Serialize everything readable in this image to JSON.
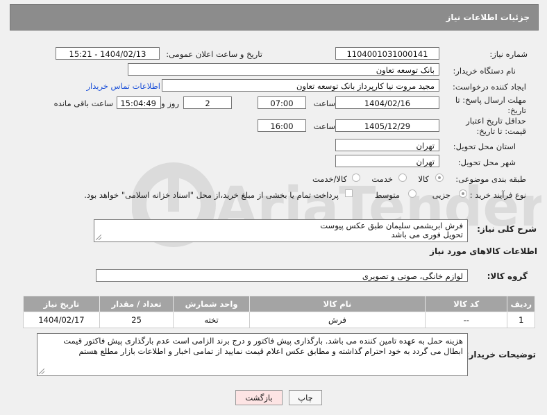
{
  "header": {
    "title": "جزئیات اطلاعات نیاز"
  },
  "form": {
    "need_number": {
      "label": "شماره نیاز:",
      "value": "1104001031000141"
    },
    "announce_datetime": {
      "label": "تاریخ و ساعت اعلان عمومی:",
      "value": "1404/02/13 - 15:21"
    },
    "buyer_org": {
      "label": "نام دستگاه خریدار:",
      "value": "بانک توسعه تعاون"
    },
    "requester": {
      "label": "ایجاد کننده درخواست:",
      "value": "مجید مروت نیا کارپرداز بانک توسعه تعاون",
      "contact_link": "اطلاعات تماس خریدار"
    },
    "reply_deadline": {
      "label": "مهلت ارسال پاسخ: تا تاریخ:",
      "date": "1404/02/16",
      "time_label": "ساعت",
      "time": "07:00",
      "days": "2",
      "days_label": "روز و",
      "remaining": "15:04:49",
      "remaining_label": "ساعت باقی مانده"
    },
    "price_validity": {
      "label": "حداقل تاریخ اعتبار قیمت: تا تاریخ:",
      "date": "1405/12/29",
      "time_label": "ساعت",
      "time": "16:00"
    },
    "delivery_province": {
      "label": "استان محل تحویل:",
      "value": "تهران"
    },
    "delivery_city": {
      "label": "شهر محل تحویل:",
      "value": "تهران"
    },
    "category": {
      "label": "طبقه بندی موضوعی:",
      "options": [
        "کالا",
        "خدمت",
        "کالا/خدمت"
      ],
      "selected": "کالا"
    },
    "purchase_process": {
      "label": "نوع فرآیند خرید :",
      "options": [
        "جزیی",
        "متوسط"
      ],
      "selected": "جزیی",
      "payment_note": "پرداخت تمام یا بخشی از مبلغ خرید،از محل \"اسناد خزانه اسلامی\" خواهد بود."
    }
  },
  "summary": {
    "label": "شرح کلی نیاز:",
    "line1": "فرش ابریشمی سلیمان طبق عکس پیوست",
    "line2": "تحویل فوری می باشد"
  },
  "goods": {
    "section_title": "اطلاعات کالاهای مورد نیاز",
    "group_label": "گروه کالا:",
    "group_value": "لوازم خانگی، صوتی و تصویری",
    "columns": [
      "ردیف",
      "کد کالا",
      "نام کالا",
      "واحد شمارش",
      "تعداد / مقدار",
      "تاریخ نیاز"
    ],
    "rows": [
      [
        "1",
        "--",
        "فرش",
        "تخته",
        "25",
        "1404/02/17"
      ]
    ]
  },
  "buyer_notes": {
    "label": "توضیحات خریدار:",
    "text": "هزینه حمل به عهده تامین کننده می باشد. بارگذاری پیش فاکتور و درج برند الزامی است عدم بارگذاری پیش فاکتور قیمت ابطال می گردد به خود احترام گذاشته و مطابق عکس اعلام قیمت نمایید از تمامی اخبار و اطلاعات بازار مطلع هستم"
  },
  "buttons": {
    "print": "چاپ",
    "back": "بازگشت"
  },
  "colors": {
    "header_bg": "#8c8c8c",
    "table_header_bg": "#a4a4a4",
    "link": "#1a4fd8",
    "back_button_bg": "#fde4e4"
  },
  "watermark": "AriaTender.neT"
}
